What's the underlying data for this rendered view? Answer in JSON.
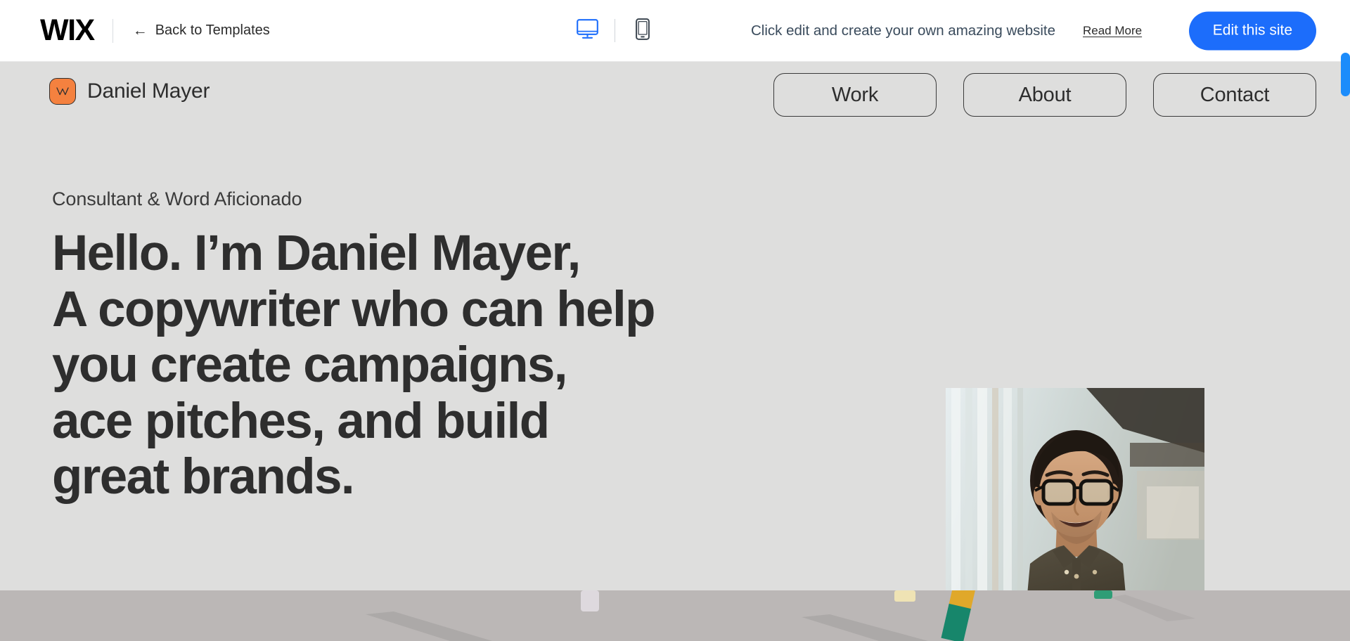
{
  "wix_bar": {
    "logo_text": "WIX",
    "back_label": "Back to Templates",
    "back_arrow": "←",
    "devices": [
      {
        "name": "desktop-view-button",
        "icon": "desktop-icon",
        "active": true
      },
      {
        "name": "mobile-view-button",
        "icon": "mobile-icon",
        "active": false
      }
    ],
    "promo_text": "Click edit and create your own amazing website",
    "read_more_label": "Read More",
    "edit_button_label": "Edit this site",
    "accent_blue": "#1c6dfb",
    "text_color": "#2b2b2b",
    "promo_color": "#3a4b5c"
  },
  "site": {
    "background": "#dededd",
    "brand": {
      "logo_icon": "crown-w-monogram-icon",
      "logo_background": "#f4813f",
      "name": "Daniel Mayer"
    },
    "nav": [
      {
        "label": "Work"
      },
      {
        "label": "About"
      },
      {
        "label": "Contact"
      }
    ],
    "hero": {
      "subtitle": "Consultant & Word Aficionado",
      "title_lines": [
        "Hello. I’m Daniel Mayer,",
        "A copywriter who can help",
        "you create campaigns,",
        "ace pitches, and build",
        "great brands."
      ],
      "title_color": "#2e2e2e"
    },
    "portrait_alt": "smiling man with glasses in olive shirt",
    "band_alt": "colored pencils on light gray surface"
  },
  "scrollbar": {
    "thumb_color": "#1c8cfb"
  }
}
